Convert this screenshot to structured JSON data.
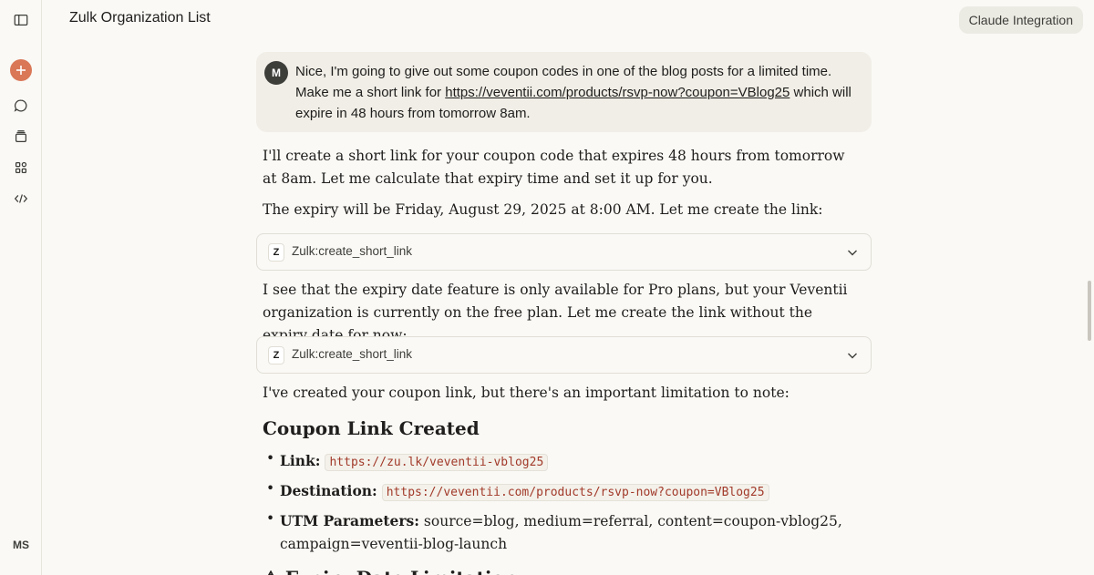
{
  "header": {
    "title": "Zulk Organization List",
    "integration_button": "Claude Integration"
  },
  "sidebar": {
    "user_initials": "MS",
    "icons": [
      "sidebar-toggle-icon",
      "new-chat-icon",
      "chats-icon",
      "projects-icon",
      "artifacts-icon",
      "code-icon"
    ]
  },
  "user_message": {
    "avatar": "M",
    "text_before": "Nice, I'm going to give out some coupon codes in one of the blog posts for a limited time. Make me a short link for ",
    "link": "https://veventii.com/products/rsvp-now?coupon=VBlog25",
    "text_after": " which will expire in 48 hours from tomorrow 8am."
  },
  "assistant": {
    "p1": "I'll create a short link for your coupon code that expires 48 hours from tomorrow at 8am. Let me calculate that expiry time and set it up for you.",
    "p2": "The expiry will be Friday, August 29, 2025 at 8:00 AM. Let me create the link:",
    "tool1": {
      "badge": "Z",
      "name": "Zulk:create_short_link"
    },
    "p3": "I see that the expiry date feature is only available for Pro plans, but your Veventii organization is currently on the free plan. Let me create the link without the expiry date for now:",
    "tool2": {
      "badge": "Z",
      "name": "Zulk:create_short_link"
    },
    "p4": "I've created your coupon link, but there's an important limitation to note:",
    "heading": "Coupon Link Created",
    "items": [
      {
        "label": "Link:",
        "code": "https://zu.lk/veventii-vblog25"
      },
      {
        "label": "Destination:",
        "code": "https://veventii.com/products/rsvp-now?coupon=VBlog25"
      },
      {
        "label": "UTM Parameters:",
        "text": " source=blog, medium=referral, content=coupon-vblog25, campaign=veventii-blog-launch"
      }
    ],
    "next_heading": "⚠ Expiry Date Limitation"
  },
  "colors": {
    "background": "#faf9f5",
    "accent": "#d97757",
    "code_text": "#a23a2a"
  }
}
